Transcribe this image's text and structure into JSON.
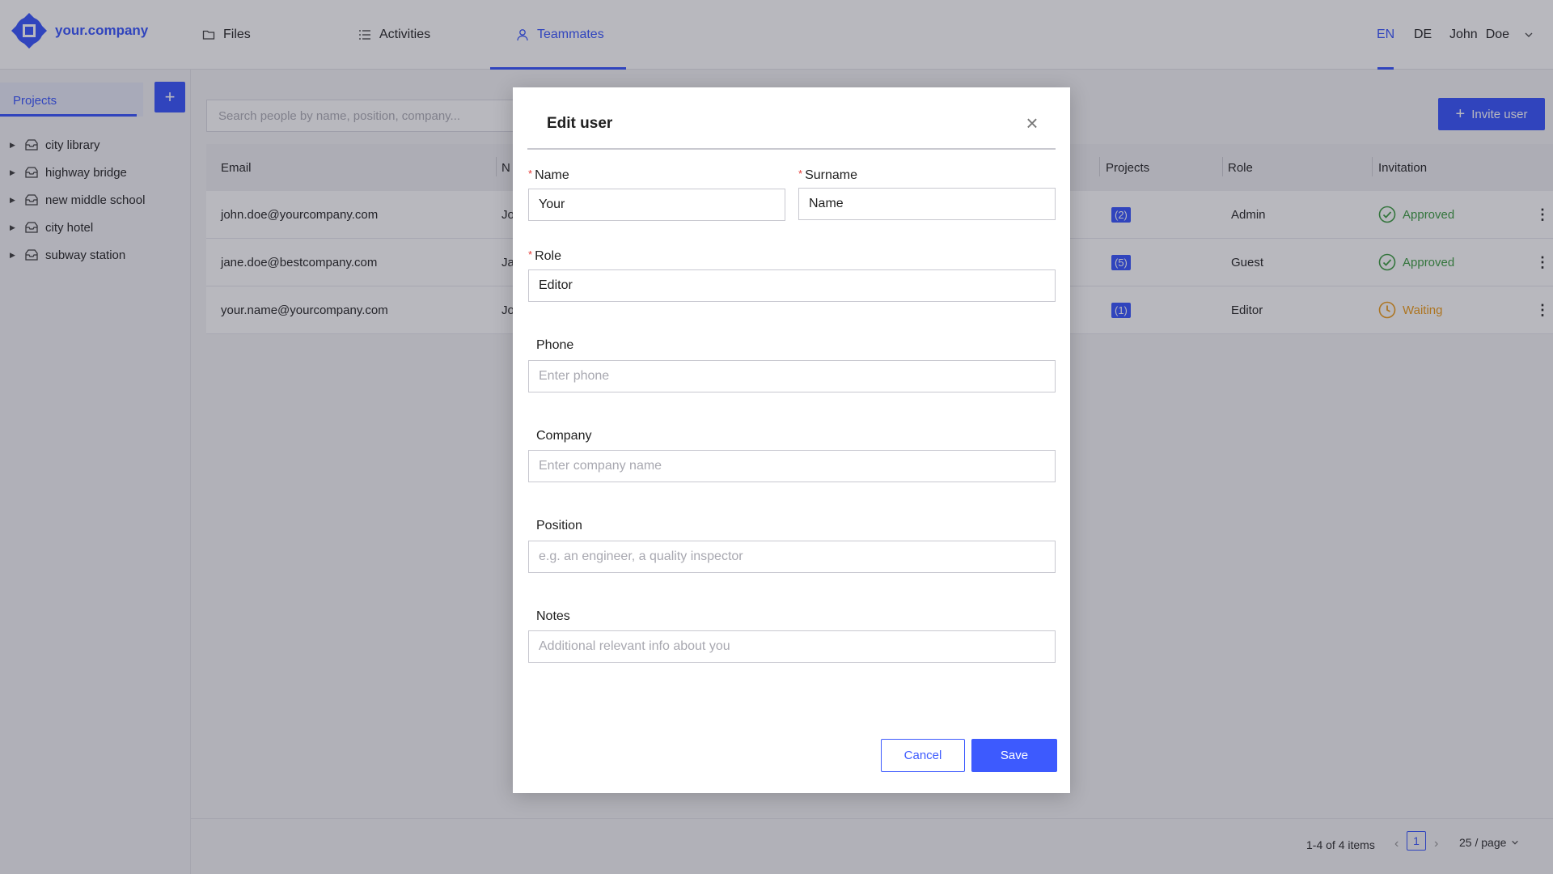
{
  "app": {
    "brand": "your.company",
    "nav": [
      {
        "label": "Files",
        "icon": "folder-icon"
      },
      {
        "label": "Activities",
        "icon": "list-icon"
      },
      {
        "label": "Teammates",
        "icon": "user-icon",
        "active": true
      }
    ],
    "languages": [
      "EN",
      "DE"
    ],
    "active_language": "EN",
    "user": {
      "first": "John",
      "last": "Doe"
    }
  },
  "sidebar": {
    "tab_label": "Projects",
    "add_label": "+",
    "projects": [
      "city library",
      "highway bridge",
      "new middle school",
      "city hotel",
      "subway station"
    ]
  },
  "teammates": {
    "search_placeholder": "Search people by name, position, company...",
    "invite_label": "Invite user",
    "columns": {
      "email": "Email",
      "name": "N",
      "projects": "Projects",
      "role": "Role",
      "invitation": "Invitation"
    },
    "rows": [
      {
        "email": "john.doe@yourcompany.com",
        "name": "Jo",
        "projects": "(2)",
        "role": "Admin",
        "invitation": "Approved",
        "status": "approved"
      },
      {
        "email": "jane.doe@bestcompany.com",
        "name": "Ja",
        "projects": "(5)",
        "role": "Guest",
        "invitation": "Approved",
        "status": "approved"
      },
      {
        "email": "your.name@yourcompany.com",
        "name": "Jo",
        "projects": "(1)",
        "role": "Editor",
        "invitation": "Waiting",
        "status": "waiting"
      }
    ],
    "pagination": {
      "summary": "1-4 of 4 items",
      "page": "1",
      "page_size": "25 / page"
    }
  },
  "modal": {
    "title": "Edit user",
    "required_mark": "*",
    "fields": {
      "name": {
        "label": "Name",
        "value": "Your"
      },
      "surname": {
        "label": "Surname",
        "value": "Name"
      },
      "role": {
        "label": "Role",
        "value": "Editor"
      },
      "phone": {
        "label": "Phone",
        "placeholder": "Enter phone"
      },
      "company": {
        "label": "Company",
        "placeholder": "Enter company name"
      },
      "position": {
        "label": "Position",
        "placeholder": "e.g. an engineer, a quality inspector"
      },
      "notes": {
        "label": "Notes",
        "placeholder": "Additional relevant info about you"
      }
    },
    "cancel_label": "Cancel",
    "save_label": "Save"
  },
  "colors": {
    "accent": "#3d5afe",
    "approved": "#43a047",
    "waiting": "#f0a020",
    "required": "#e53935"
  }
}
